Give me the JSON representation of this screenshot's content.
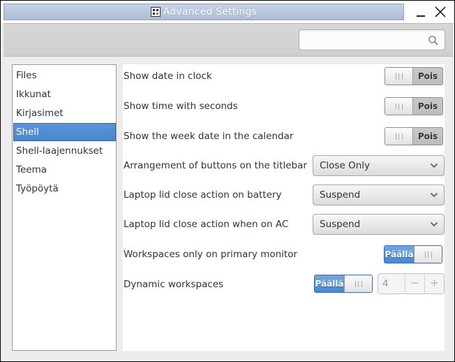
{
  "window": {
    "title": "Advanced Settings",
    "app_icon_text": "TWEAK"
  },
  "search": {
    "placeholder": "",
    "value": ""
  },
  "sidebar": {
    "items": [
      {
        "label": "Files"
      },
      {
        "label": "Ikkunat"
      },
      {
        "label": "Kirjasimet"
      },
      {
        "label": "Shell"
      },
      {
        "label": "Shell-laajennukset"
      },
      {
        "label": "Teema"
      },
      {
        "label": "Työpöytä"
      }
    ],
    "selected": "Shell"
  },
  "settings": {
    "show_date": {
      "label": "Show date in clock",
      "state": "Pois"
    },
    "show_seconds": {
      "label": "Show time with seconds",
      "state": "Pois"
    },
    "week_date": {
      "label": "Show the week date in the calendar",
      "state": "Pois"
    },
    "button_arrangement": {
      "label": "Arrangement of buttons on the titlebar",
      "value": "Close Only"
    },
    "lid_battery": {
      "label": "Laptop lid close action on battery",
      "value": "Suspend"
    },
    "lid_ac": {
      "label": "Laptop lid close action when on AC",
      "value": "Suspend"
    },
    "primary_monitor": {
      "label": "Workspaces only on primary monitor",
      "state": "Päällä"
    },
    "dynamic_workspaces": {
      "label": "Dynamic workspaces",
      "state": "Päällä",
      "count": "4",
      "minus": "−",
      "plus": "+"
    }
  },
  "colors": {
    "accent": "#4a86cf",
    "titlebar": "#aabcd7"
  }
}
